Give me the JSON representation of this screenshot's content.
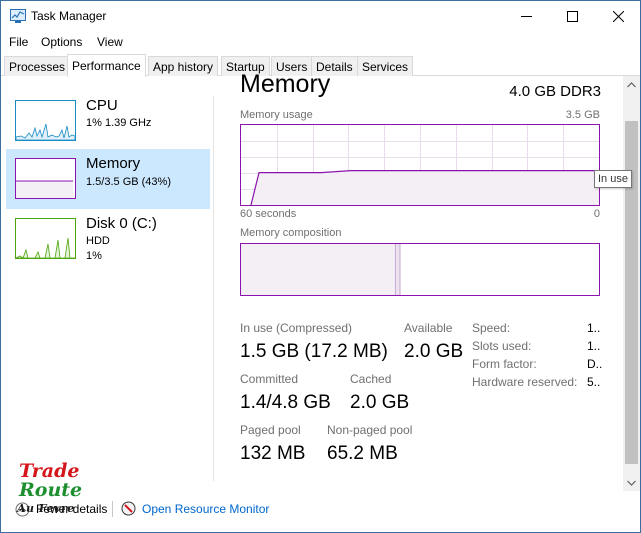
{
  "window": {
    "title": "Task Manager"
  },
  "menu": {
    "file": "File",
    "options": "Options",
    "view": "View"
  },
  "tabs": [
    {
      "label": "Processes",
      "active": false
    },
    {
      "label": "Performance",
      "active": true
    },
    {
      "label": "App history",
      "active": false
    },
    {
      "label": "Startup",
      "active": false
    },
    {
      "label": "Users",
      "active": false
    },
    {
      "label": "Details",
      "active": false
    },
    {
      "label": "Services",
      "active": false
    }
  ],
  "sidebar": [
    {
      "title": "CPU",
      "lines": [
        "1%  1.39 GHz"
      ],
      "color": "#1a8bc4",
      "selected": false
    },
    {
      "title": "Memory",
      "lines": [
        "1.5/3.5 GB (43%)"
      ],
      "color": "#8b12ae",
      "selected": true
    },
    {
      "title": "Disk 0 (C:)",
      "lines": [
        "HDD",
        "1%"
      ],
      "color": "#4da60c",
      "selected": false
    }
  ],
  "detail": {
    "title": "Memory",
    "spec": "4.0 GB DDR3",
    "usage_label": "Memory usage",
    "usage_max": "3.5 GB",
    "time_left": "60 seconds",
    "time_right": "0",
    "composition_label": "Memory composition",
    "usage_level": 0.43,
    "in_use_fraction": 0.43,
    "modified_fraction": 0.01,
    "tooltip": "In use",
    "stats": {
      "in_use_label": "In use (Compressed)",
      "in_use_value": "1.5 GB (17.2 MB)",
      "available_label": "Available",
      "available_value": "2.0 GB",
      "committed_label": "Committed",
      "committed_value": "1.4/4.8 GB",
      "cached_label": "Cached",
      "cached_value": "2.0 GB",
      "paged_label": "Paged pool",
      "paged_value": "132 MB",
      "nonpaged_label": "Non-paged pool",
      "nonpaged_value": "65.2 MB"
    },
    "properties": [
      {
        "label": "Speed:",
        "value": "1.."
      },
      {
        "label": "Slots used:",
        "value": "1.."
      },
      {
        "label": "Form factor:",
        "value": "D.."
      },
      {
        "label": "Hardware reserved:",
        "value": "5.."
      }
    ]
  },
  "footer": {
    "fewer_details": "Fewer details",
    "resource_monitor": "Open Resource Monitor"
  },
  "watermark": {
    "line1": "Trade",
    "line2": "Route",
    "line3": "Au Fevre"
  },
  "colors": {
    "memory": "#8b12ae",
    "cpu": "#1a8bc4",
    "disk": "#4da60c",
    "selected": "#cce8ff",
    "link": "#0066cc"
  }
}
